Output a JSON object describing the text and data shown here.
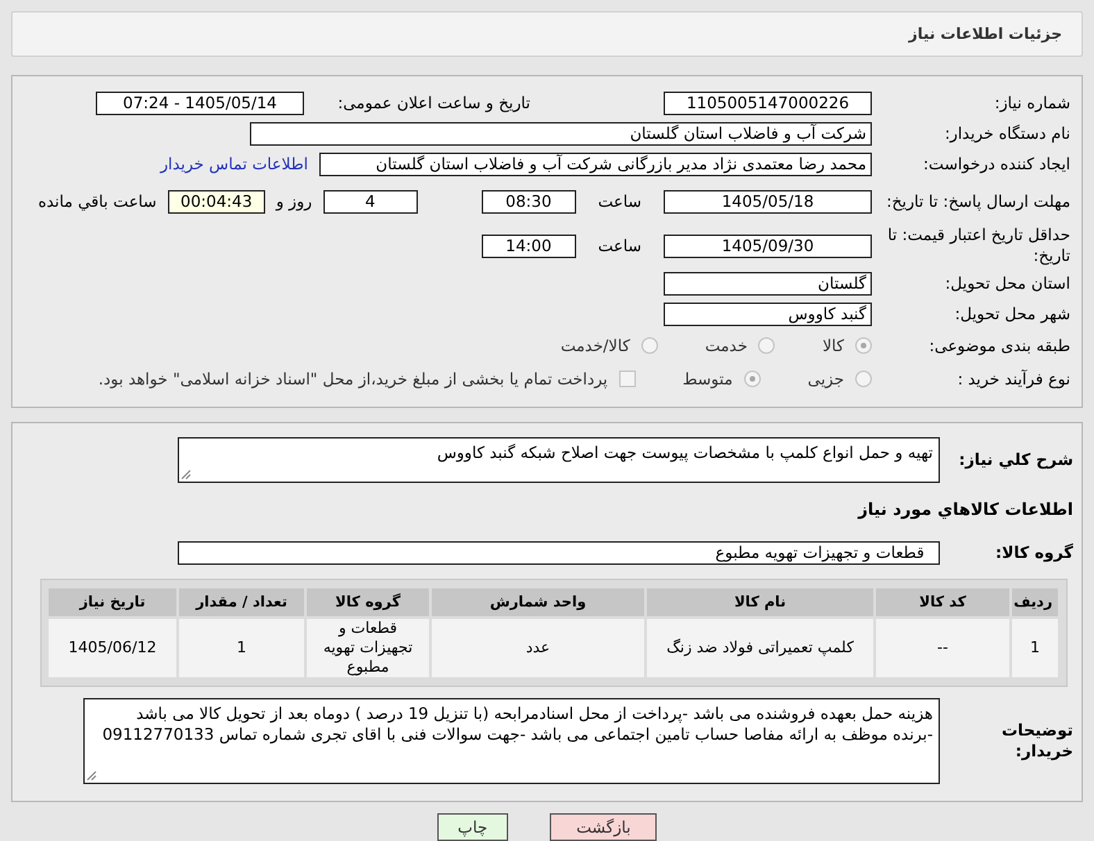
{
  "header": {
    "title": "جزئیات اطلاعات نیاز"
  },
  "need_number": {
    "label": "شماره نیاز:",
    "value": "1105005147000226"
  },
  "announce": {
    "label": "تاریخ و ساعت اعلان عمومی:",
    "value": "1405/05/14 - 07:24"
  },
  "buyer_org": {
    "label": "نام دستگاه خریدار:",
    "value": "شرکت آب و فاضلاب استان گلستان"
  },
  "requester": {
    "label": "ایجاد کننده درخواست:",
    "value": "محمد رضا معتمدی نژاد مدیر بازرگانی شرکت آب و فاضلاب استان گلستان",
    "link": "اطلاعات تماس خریدار"
  },
  "deadline": {
    "label": "مهلت ارسال پاسخ: تا تاریخ:",
    "date": "1405/05/18",
    "time_label": "ساعت",
    "time": "08:30",
    "days": "4",
    "days_label": "روز و",
    "remaining": "00:04:43",
    "remaining_label": "ساعت باقي مانده"
  },
  "validity": {
    "label": "حداقل تاریخ اعتبار قیمت: تا تاریخ:",
    "date": "1405/09/30",
    "time_label": "ساعت",
    "time": "14:00"
  },
  "province": {
    "label": "استان محل تحویل:",
    "value": "گلستان"
  },
  "city": {
    "label": "شهر محل تحویل:",
    "value": "گنبد کاووس"
  },
  "category": {
    "label": "طبقه بندی موضوعی:",
    "options": [
      {
        "label": "کالا",
        "selected": true
      },
      {
        "label": "خدمت",
        "selected": false
      },
      {
        "label": "کالا/خدمت",
        "selected": false
      }
    ]
  },
  "process": {
    "label": "نوع فرآیند خرید :",
    "options": [
      {
        "label": "جزیی",
        "selected": false
      },
      {
        "label": "متوسط",
        "selected": true
      }
    ],
    "payment": {
      "checked": false,
      "text": "پرداخت تمام یا بخشی از مبلغ خرید،از محل \"اسناد خزانه اسلامی\" خواهد بود."
    }
  },
  "description": {
    "label": "شرح کلي نیاز:",
    "value": "تهیه و حمل انواع کلمپ با مشخصات پیوست جهت اصلاح شبکه گنبد کاووس"
  },
  "goods_heading": "اطلاعات کالاهاي مورد نیاز",
  "goods_group": {
    "label": "گروه کالا:",
    "value": "قطعات و تجهیزات تهویه مطبوع"
  },
  "table": {
    "columns": [
      "ردیف",
      "کد کالا",
      "نام کالا",
      "واحد شمارش",
      "گروه کالا",
      "تعداد / مقدار",
      "تاریخ نیاز"
    ],
    "rows": [
      [
        "1",
        "--",
        "کلمپ تعمیراتی فولاد ضد زنگ",
        "عدد",
        "قطعات و تجهیزات تهویه مطبوع",
        "1",
        "1405/06/12"
      ]
    ]
  },
  "buyer_notes": {
    "label": "توضیحات خریدار:",
    "lines": [
      "هزینه حمل بعهده فروشنده می باشد -پرداخت از محل اسنادمرابحه (با تنزیل 19 درصد ) دوماه بعد از تحویل کالا می باشد",
      "-برنده موظف به ارائه مفاصا حساب تامین اجتماعی می باشد -جهت سوالات فنی با اقای تجری شماره تماس 09112770133"
    ]
  },
  "buttons": [
    {
      "label": "بازگشت",
      "kind": "back"
    },
    {
      "label": "چاپ",
      "kind": "print"
    }
  ]
}
